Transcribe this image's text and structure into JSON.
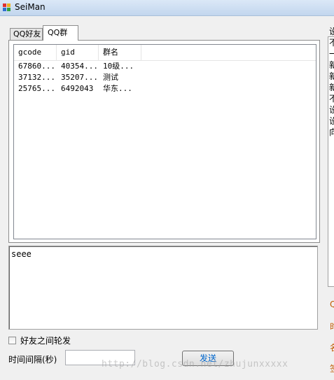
{
  "window": {
    "title": "SeiMan"
  },
  "tabs": [
    {
      "label": "QQ好友",
      "active": false
    },
    {
      "label": "QQ群",
      "active": true
    }
  ],
  "group_list": {
    "columns": [
      "gcode",
      "gid",
      "群名"
    ],
    "rows": [
      [
        "67860...",
        "40354...",
        "10级..."
      ],
      [
        "37132...",
        "35207...",
        "测试"
      ],
      [
        "25765...",
        "6492043",
        "华东..."
      ]
    ]
  },
  "message_box": {
    "value": "seee"
  },
  "rotate_friends": {
    "label": "好友之间轮发",
    "checked": false
  },
  "interval": {
    "label": "时间间隔(秒)",
    "value": ""
  },
  "send_button": {
    "label": "发送"
  },
  "right_panel": {
    "top_char": "设",
    "chars": [
      "不",
      "一",
      "新",
      "新",
      "新",
      "不",
      "设",
      "设",
      "向"
    ],
    "orange_chars": [
      "Q",
      "时",
      "名",
      "签"
    ]
  },
  "watermark": {
    "text": "http://blog.csdn.net/zhujunxxxxx"
  },
  "colors": {
    "titlebar": "#c2d6ee",
    "send_text": "#0066cc",
    "orange_text": "#c25a00"
  }
}
